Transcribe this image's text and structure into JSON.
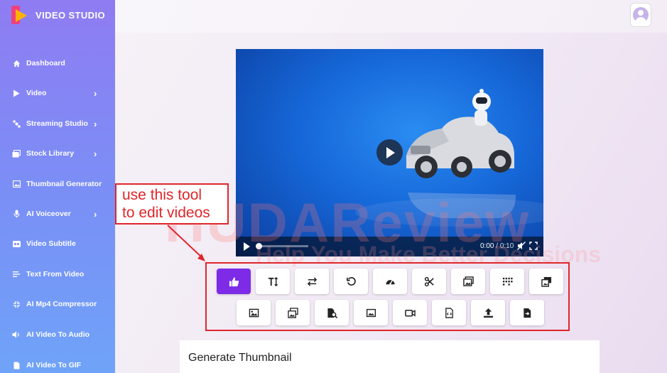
{
  "app": {
    "title": "VIDEO STUDIO"
  },
  "sidebar": {
    "items": [
      {
        "label": "Dashboard",
        "icon": "home-icon",
        "has_chevron": false
      },
      {
        "label": "Video",
        "icon": "play-icon",
        "has_chevron": true
      },
      {
        "label": "Streaming Studio",
        "icon": "satellite-icon",
        "has_chevron": true
      },
      {
        "label": "Stock Library",
        "icon": "images-icon",
        "has_chevron": true
      },
      {
        "label": "Thumbnail Generator",
        "icon": "image-icon",
        "has_chevron": false
      },
      {
        "label": "AI Voiceover",
        "icon": "microphone-icon",
        "has_chevron": true
      },
      {
        "label": "Video Subtitle",
        "icon": "closed-caption-icon",
        "has_chevron": false
      },
      {
        "label": "Text From Video",
        "icon": "text-lines-icon",
        "has_chevron": false
      },
      {
        "label": "AI Mp4 Compressor",
        "icon": "compress-icon",
        "has_chevron": false
      },
      {
        "label": "AI Video To Audio",
        "icon": "volume-icon",
        "has_chevron": false
      },
      {
        "label": "AI Video To GIF",
        "icon": "file-icon",
        "has_chevron": false
      }
    ]
  },
  "player": {
    "time_current": "0:00",
    "time_separator": " / ",
    "time_total": "0:10",
    "progress": 0.0
  },
  "watermark": {
    "main": "HUDAReview",
    "tagline": "Help You Make Better Decisions"
  },
  "callout": {
    "line1": "use this tool",
    "line2": "to edit videos"
  },
  "tools": {
    "row1": [
      "thumbs-up-icon",
      "text-height-icon",
      "swap-arrows-icon",
      "undo-icon",
      "speedometer-icon",
      "scissors-icon",
      "photo-stack-icon",
      "grid-dots-icon",
      "image-overlay-icon"
    ],
    "row2": [
      "image-icon",
      "images-icon",
      "file-search-icon",
      "picture-icon",
      "video-camera-icon",
      "file-code-icon",
      "upload-icon",
      "file-export-icon"
    ],
    "active_index": 0,
    "active_color": "#7d2be7"
  },
  "panel": {
    "title": "Generate Thumbnail"
  }
}
